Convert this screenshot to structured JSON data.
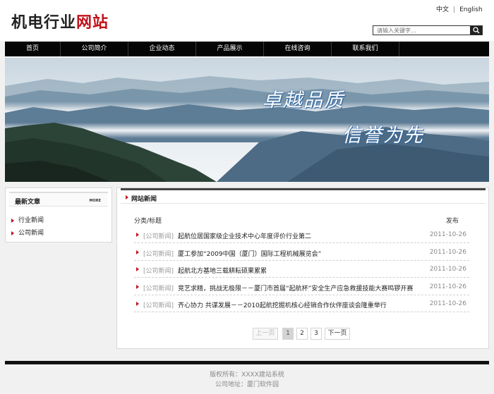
{
  "header": {
    "logo_text": "机电行业网站",
    "lang_cn": "中文",
    "lang_sep": "|",
    "lang_en": "English",
    "search_placeholder": "请输入关键字...",
    "search_icon": "search-icon"
  },
  "nav": {
    "items": [
      {
        "label": "首页"
      },
      {
        "label": "公司简介"
      },
      {
        "label": "企业动态"
      },
      {
        "label": "产品展示"
      },
      {
        "label": "在线咨询"
      },
      {
        "label": "联系我们"
      }
    ]
  },
  "banner": {
    "slogan1": "卓越品质",
    "slogan2": "信誉为先"
  },
  "sidebar": {
    "title": "最新文章",
    "more": "MORE",
    "items": [
      {
        "label": "行业新闻"
      },
      {
        "label": "公司新闻"
      }
    ]
  },
  "main": {
    "title": "网站新闻",
    "col_title": "分类/标题",
    "col_date": "发布",
    "news": [
      {
        "category": "[公司新闻]",
        "title": "起航位居国家级企业技术中心年度评价行业第二",
        "date": "2011-10-26"
      },
      {
        "category": "[公司新闻]",
        "title": "厦工参加“2009中国（厦门）国际工程机械展览会”",
        "date": "2011-10-26"
      },
      {
        "category": "[公司新闻]",
        "title": "起航北方基地三载耕耘硕果累累",
        "date": "2011-10-26"
      },
      {
        "category": "[公司新闻]",
        "title": "竞艺求精，挑战无极限－－厦门市首届“起航杯”安全生产应急救援技能大赛鸣锣开赛",
        "date": "2011-10-26"
      },
      {
        "category": "[公司新闻]",
        "title": "齐心协力 共谋发展－－2010起航挖掘机核心经销合作伙伴座谈会隆重举行",
        "date": "2011-10-26"
      }
    ],
    "pager": {
      "prev": "上一页",
      "pages": [
        "1",
        "2",
        "3"
      ],
      "next": "下一页"
    }
  },
  "footer": {
    "copyright": "版权所有：XXXX建站系统",
    "address": "公司地址：厦门软件园"
  },
  "colors": {
    "accent": "#c0121a",
    "nav_bg": "#050505",
    "page_bg": "#f1f1f1"
  }
}
